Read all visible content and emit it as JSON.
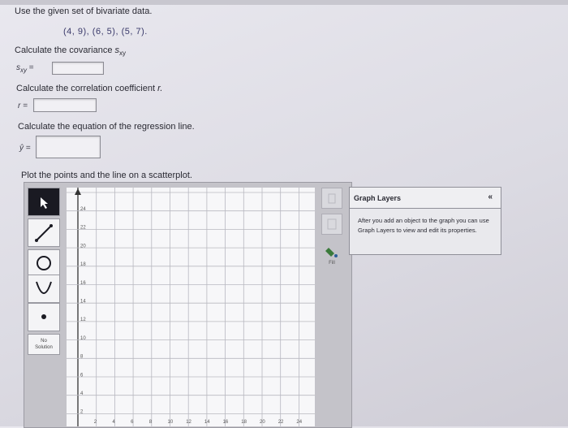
{
  "intro": "Use the given set of bivariate data.",
  "dataset": "(4, 9), (6, 5), (5, 7).",
  "covariance": {
    "prompt": "Calculate the covariance",
    "prompt_symbol": "s",
    "prompt_sub": "xy",
    "label": "s",
    "label_sub": "xy",
    "eq": "=",
    "value": ""
  },
  "correlation": {
    "prompt": "Calculate the correlation coefficient",
    "prompt_var": "r.",
    "label": "r =",
    "value": ""
  },
  "regression": {
    "prompt": "Calculate the equation of the regression line.",
    "label": "ŷ =",
    "value": ""
  },
  "plot_prompt": "Plot the points and the line on a scatterplot.",
  "toolbar": {
    "tools": [
      {
        "name": "pointer-tool-icon",
        "glyph": "↖",
        "selected": true
      },
      {
        "name": "line-tool-icon",
        "glyph": "↗",
        "selected": false
      },
      {
        "name": "circle-tool-icon",
        "glyph": "○",
        "selected": false
      },
      {
        "name": "parabola-tool-icon",
        "glyph": "∪",
        "selected": false
      },
      {
        "name": "point-tool-icon",
        "glyph": "•",
        "selected": false
      }
    ],
    "no_solution": [
      "No",
      "Solution"
    ]
  },
  "graph": {
    "y_ticks": [
      "24",
      "22",
      "20",
      "18",
      "16",
      "14",
      "12",
      "10",
      "8",
      "6",
      "4",
      "2"
    ],
    "x_ticks": [
      "2",
      "4",
      "6",
      "8",
      "10",
      "12",
      "14",
      "16",
      "18",
      "20",
      "22",
      "24"
    ],
    "fill_label": "Fill"
  },
  "layers": {
    "title": "Graph Layers",
    "collapse": "«",
    "body": "After you add an object to the graph you can use Graph Layers to view and edit its properties."
  },
  "colors": {
    "accent_text": "#3a3a6a",
    "selected_tool": "#1a1a22",
    "grid_line": "#b8b8c0"
  }
}
